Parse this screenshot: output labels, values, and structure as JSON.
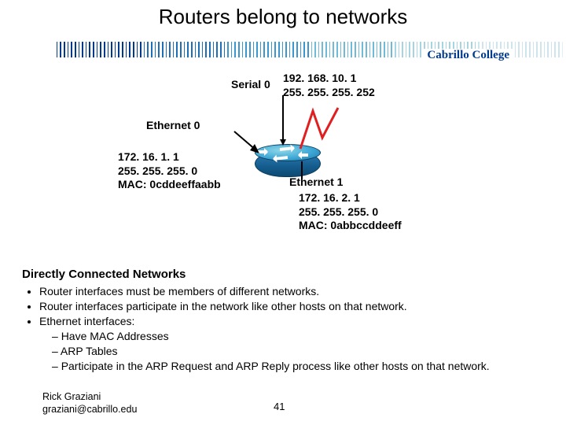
{
  "title": "Routers belong to networks",
  "brand": "Cabrillo College",
  "diagram": {
    "serial0": {
      "name": "Serial 0",
      "ip": "192. 168. 10. 1",
      "mask": "255. 255. 255. 252"
    },
    "eth0": {
      "name": "Ethernet 0",
      "ip": "172. 16. 1. 1",
      "mask": "255. 255. 255. 0",
      "mac": "MAC: 0cddeeffaabb"
    },
    "eth1": {
      "name": "Ethernet 1",
      "ip": "172. 16. 2. 1",
      "mask": "255. 255. 255. 0",
      "mac": "MAC: 0abbccddeeff"
    }
  },
  "body": {
    "heading": "Directly Connected Networks",
    "b1": "Router interfaces must be members of different networks.",
    "b2": "Router interfaces participate in the network like other hosts on that network.",
    "b3": "Ethernet interfaces:",
    "s1": "Have MAC Addresses",
    "s2": "ARP Tables",
    "s3": "Participate in the ARP Request and ARP Reply process like other hosts on that network."
  },
  "footer": {
    "author": "Rick Graziani",
    "email": "graziani@cabrillo.edu",
    "page": "41"
  },
  "colors": {
    "gradient": [
      "#003a8c",
      "#1d6fb8",
      "#3d97cf",
      "#6fbad8",
      "#a7d4e3",
      "#cfe5ee",
      "#e6eff4"
    ]
  }
}
